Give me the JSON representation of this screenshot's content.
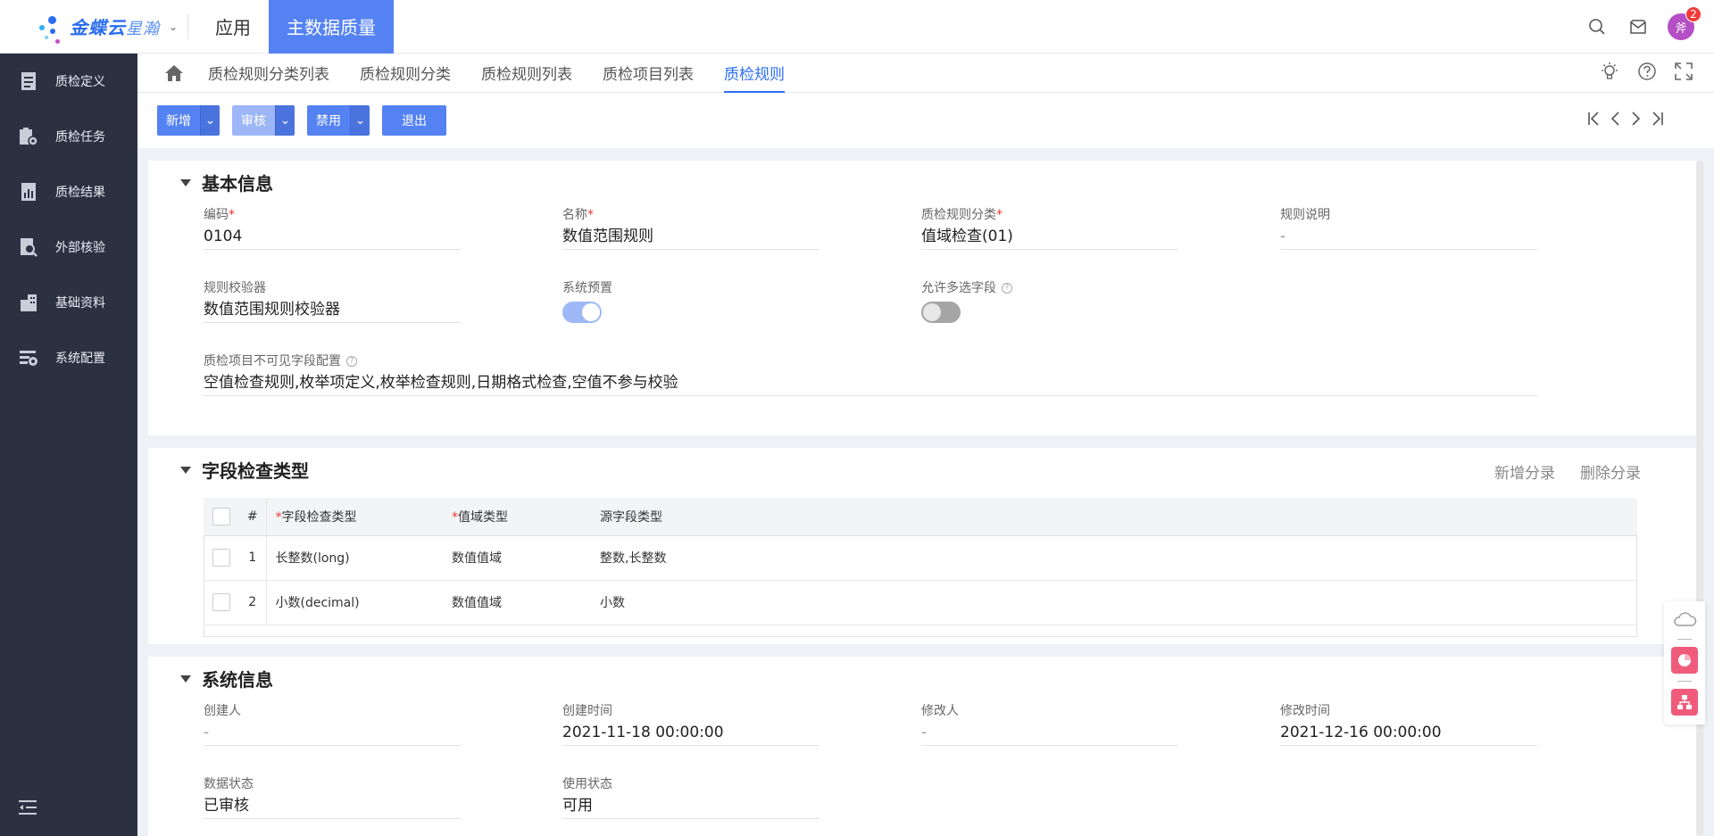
{
  "brand": {
    "name": "金蝶云",
    "sub": "星瀚"
  },
  "top_nav": {
    "apps": "应用",
    "active": "主数据质量"
  },
  "notifications": {
    "count": "2"
  },
  "user": {
    "avatar": "斧"
  },
  "sidebar": {
    "items": [
      {
        "label": "质检定义",
        "icon": "document-icon"
      },
      {
        "label": "质检任务",
        "icon": "task-gear-icon"
      },
      {
        "label": "质检结果",
        "icon": "report-icon"
      },
      {
        "label": "外部核验",
        "icon": "search-document-icon"
      },
      {
        "label": "基础资料",
        "icon": "building-icon"
      },
      {
        "label": "系统配置",
        "icon": "settings-list-icon"
      }
    ]
  },
  "tabs": [
    "质检规则分类列表",
    "质检规则分类",
    "质检规则列表",
    "质检项目列表",
    "质检规则"
  ],
  "toolbar": {
    "new": "新增",
    "audit": "审核",
    "disable": "禁用",
    "exit": "退出"
  },
  "basic": {
    "title": "基本信息",
    "code_label": "编码",
    "code": "0104",
    "name_label": "名称",
    "name": "数值范围规则",
    "category_label": "质检规则分类",
    "category": "值域检查(01)",
    "desc_label": "规则说明",
    "desc": "-",
    "validator_label": "规则校验器",
    "validator": "数值范围规则校验器",
    "preset_label": "系统预置",
    "preset_on": true,
    "multi_label": "允许多选字段",
    "multi_on": false,
    "hidden_label": "质检项目不可见字段配置",
    "hidden": "空值检查规则,枚举项定义,枚举检查规则,日期格式检查,空值不参与校验"
  },
  "fields_section": {
    "title": "字段检查类型",
    "add_entry": "新增分录",
    "delete_entry": "删除分录",
    "columns": {
      "num": "#",
      "check_type": "字段检查类型",
      "domain_type": "值域类型",
      "source_type": "源字段类型"
    },
    "rows": [
      {
        "num": "1",
        "check_type": "长整数(long)",
        "domain_type": "数值值域",
        "source_type": "整数,长整数"
      },
      {
        "num": "2",
        "check_type": "小数(decimal)",
        "domain_type": "数值值域",
        "source_type": "小数"
      }
    ]
  },
  "system": {
    "title": "系统信息",
    "creator_label": "创建人",
    "creator": "-",
    "created_label": "创建时间",
    "created": "2021-11-18 00:00:00",
    "modifier_label": "修改人",
    "modifier": "-",
    "modified_label": "修改时间",
    "modified": "2021-12-16 00:00:00",
    "data_status_label": "数据状态",
    "data_status": "已审核",
    "use_status_label": "使用状态",
    "use_status": "可用"
  },
  "colors": {
    "primary": "#5582f3",
    "sidebar": "#2c3142",
    "tab_active": "#2d6ef5",
    "required": "#e33333"
  }
}
